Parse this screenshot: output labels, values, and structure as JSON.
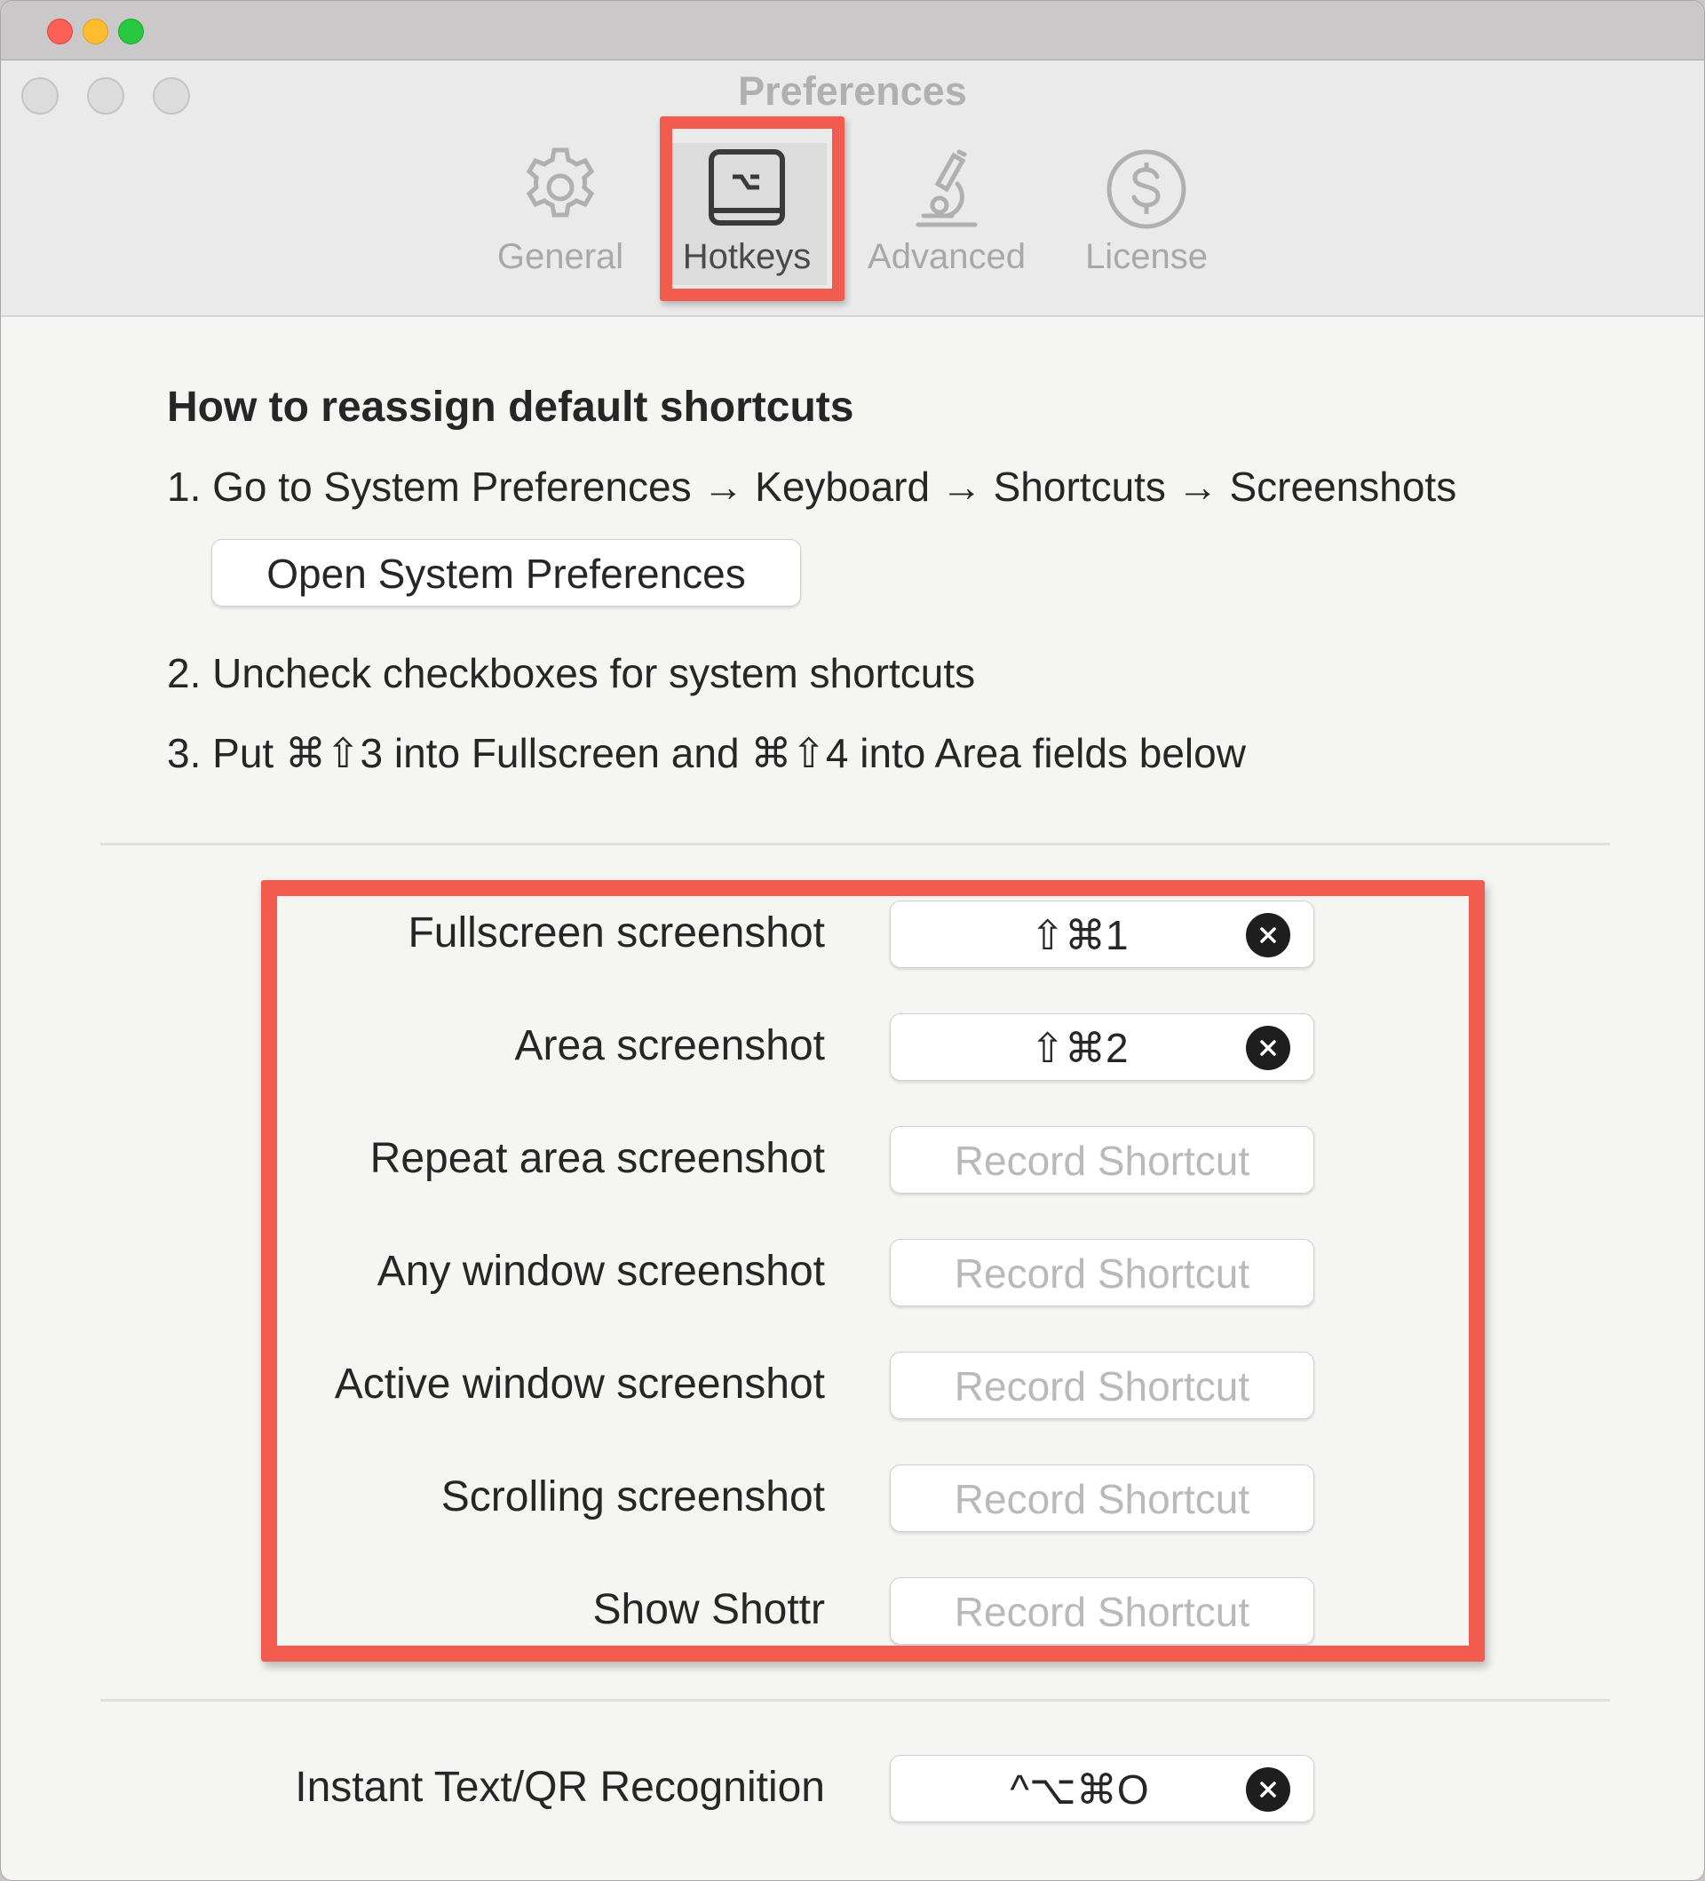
{
  "window": {
    "title": "Preferences"
  },
  "tabs": [
    {
      "label": "General",
      "icon": "gear-icon"
    },
    {
      "label": "Hotkeys",
      "icon": "keyboard-option-icon",
      "selected": true
    },
    {
      "label": "Advanced",
      "icon": "microscope-icon"
    },
    {
      "label": "License",
      "icon": "dollar-icon"
    }
  ],
  "instructions": {
    "heading": "How to reassign default shortcuts",
    "step1": "1. Go to System Preferences → Keyboard → Shortcuts → Screenshots",
    "open_button": "Open System Preferences",
    "step2": "2. Uncheck checkboxes for system shortcuts",
    "step3": "3. Put ⌘⇧3 into Fullscreen and ⌘⇧4 into Area fields below"
  },
  "shortcuts": [
    {
      "label": "Fullscreen screenshot",
      "value": "⇧⌘1",
      "placeholder": ""
    },
    {
      "label": "Area screenshot",
      "value": "⇧⌘2",
      "placeholder": ""
    },
    {
      "label": "Repeat area screenshot",
      "value": "",
      "placeholder": "Record Shortcut"
    },
    {
      "label": "Any window screenshot",
      "value": "",
      "placeholder": "Record Shortcut"
    },
    {
      "label": "Active window screenshot",
      "value": "",
      "placeholder": "Record Shortcut"
    },
    {
      "label": "Scrolling screenshot",
      "value": "",
      "placeholder": "Record Shortcut"
    },
    {
      "label": "Show Shottr",
      "value": "",
      "placeholder": "Record Shortcut"
    }
  ],
  "ocr_shortcut": {
    "label": "Instant Text/QR Recognition",
    "value": "^⌥⌘O"
  },
  "colors": {
    "highlight": "#f25c4f",
    "traffic_red": "#fe5f57",
    "traffic_yellow": "#febc2e",
    "traffic_green": "#28c840"
  }
}
